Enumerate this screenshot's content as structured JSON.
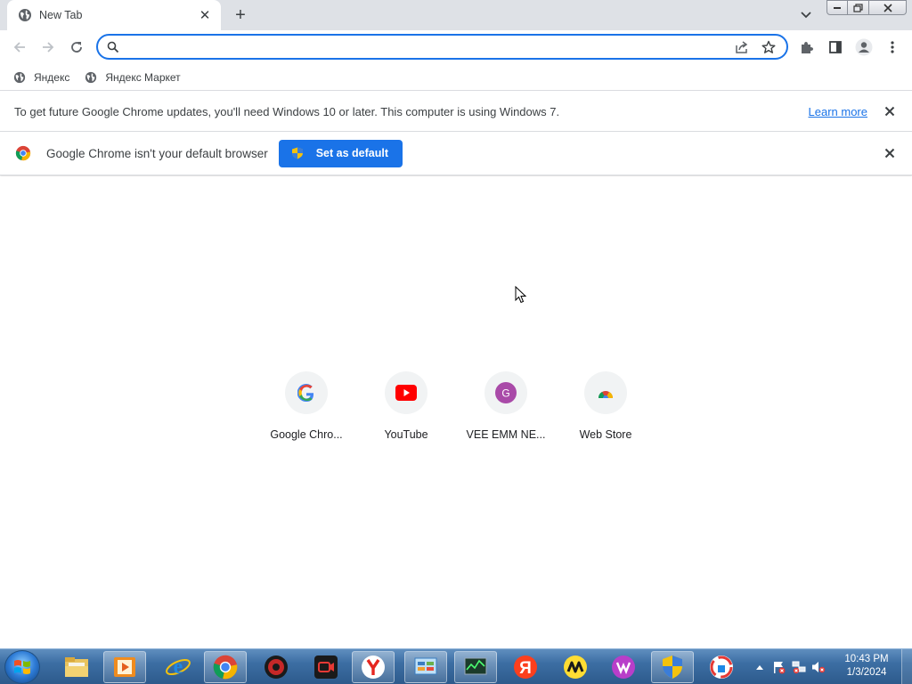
{
  "tab": {
    "title": "New Tab"
  },
  "omnibox": {
    "value": ""
  },
  "bookmarks": [
    {
      "label": "Яндекс"
    },
    {
      "label": "Яндекс Маркет"
    }
  ],
  "infobars": {
    "update": {
      "message": "To get future Google Chrome updates, you'll need Windows 10 or later. This computer is using Windows 7.",
      "link": "Learn more"
    },
    "default_browser": {
      "message": "Google Chrome isn't your default browser",
      "button": "Set as default"
    }
  },
  "shortcuts": [
    {
      "label": "Google Chro...",
      "icon": "google-icon"
    },
    {
      "label": "YouTube",
      "icon": "youtube-icon"
    },
    {
      "label": "VEE EMM NE...",
      "icon": "letter-g-avatar-icon",
      "letter": "G",
      "color": "#a94aa8"
    },
    {
      "label": "Web Store",
      "icon": "web-store-icon"
    }
  ],
  "taskbar": {
    "clock": {
      "time": "10:43 PM",
      "date": "1/3/2024"
    }
  },
  "colors": {
    "accent": "#1a73e8",
    "tabstrip": "#dee1e6"
  }
}
